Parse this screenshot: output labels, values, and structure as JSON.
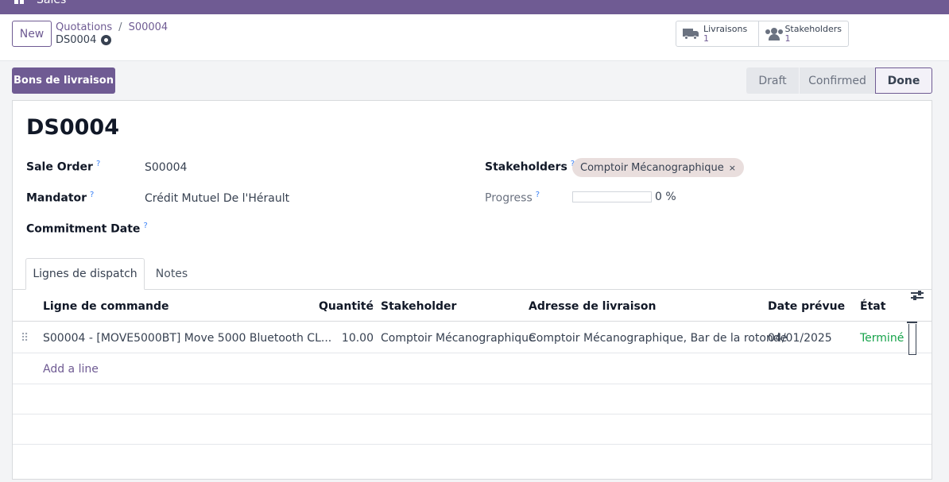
{
  "topbar": {
    "app_name": "Sales"
  },
  "control": {
    "new_label": "New",
    "breadcrumb": [
      "Quotations",
      "S00004"
    ],
    "current": "DS0004",
    "smart_buttons": [
      {
        "label": "Livraisons",
        "count": "1",
        "icon": "truck-icon"
      },
      {
        "label": "Stakeholders",
        "count": "1",
        "icon": "users-icon"
      }
    ]
  },
  "actions": {
    "primary_label": "Bons de livraison",
    "stages": [
      "Draft",
      "Confirmed",
      "Done"
    ],
    "active_stage": "Done"
  },
  "form": {
    "title": "DS0004",
    "fields": {
      "sale_order": {
        "label": "Sale Order",
        "value": "S00004"
      },
      "mandator": {
        "label": "Mandator",
        "value": "Crédit Mutuel De l'Hérault"
      },
      "commitment_date": {
        "label": "Commitment Date",
        "value": ""
      },
      "stakeholders": {
        "label": "Stakeholders",
        "tag": "Comptoir Mécanographique"
      },
      "progress": {
        "label": "Progress",
        "value": 0,
        "text": "0 %"
      }
    },
    "help_marker": "?",
    "tabs": [
      "Lignes de dispatch",
      "Notes"
    ],
    "table": {
      "headers": [
        "Ligne de commande",
        "Quantité",
        "Stakeholder",
        "Adresse de livraison",
        "Date prévue",
        "État"
      ],
      "rows": [
        {
          "line": "S00004 - [MOVE5000BT] Move 5000 Bluetooth CL...",
          "qty": "10.00",
          "stakeholder": "Comptoir Mécanographique",
          "address": "Comptoir Mécanographique, Bar de la rotonde",
          "date": "04/01/2025",
          "state": "Terminé"
        }
      ],
      "add_line": "Add a line"
    }
  }
}
